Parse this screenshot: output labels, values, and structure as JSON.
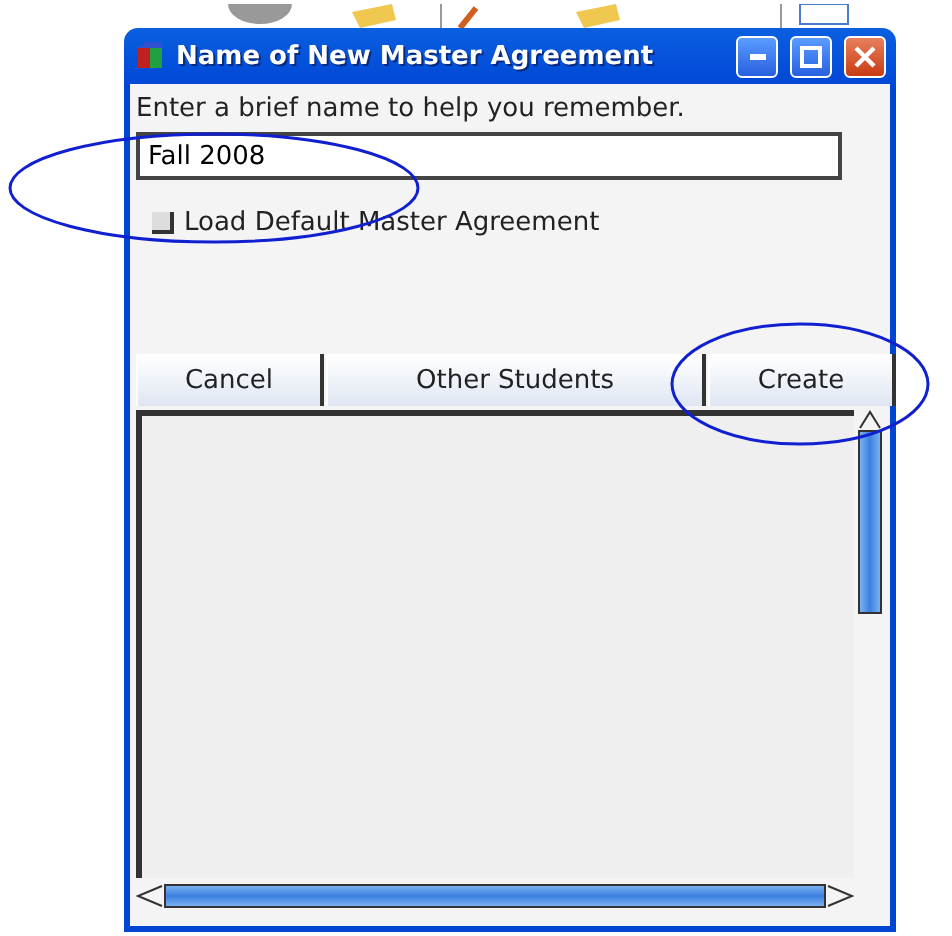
{
  "window": {
    "title": "Name of New Master Agreement"
  },
  "prompt": "Enter a brief name to help you remember.",
  "name_field": {
    "value": "Fall 2008"
  },
  "load_default": {
    "label": "Load Default Master Agreement",
    "checked": false
  },
  "buttons": [
    {
      "label": "Cancel"
    },
    {
      "label": "Other Students"
    },
    {
      "label": "Create"
    }
  ]
}
